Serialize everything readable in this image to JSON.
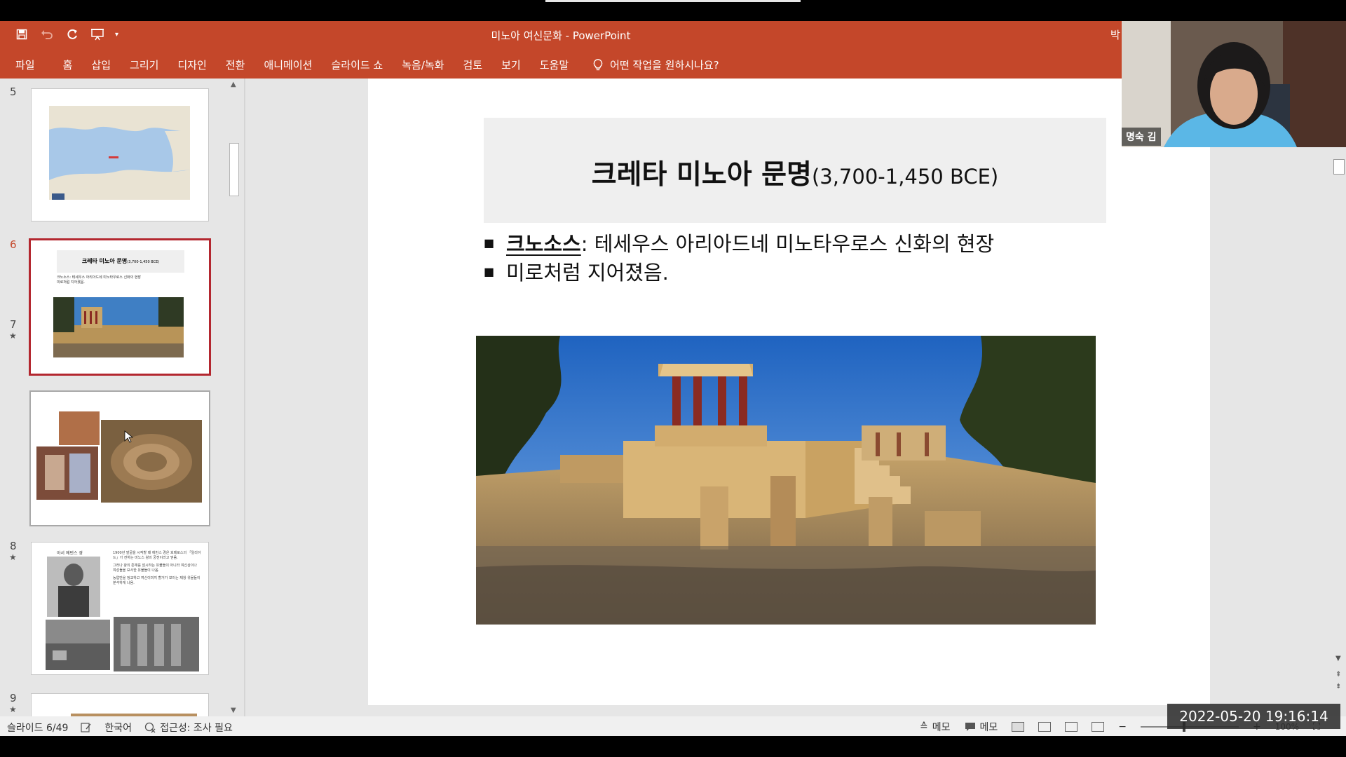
{
  "window": {
    "title": "미노아 여신문화  -  PowerPoint",
    "user_initial": "박",
    "accent": "#c4472a"
  },
  "qat": {
    "icons": [
      "save-icon",
      "undo-icon",
      "redo-icon",
      "present-from-start-icon",
      "customize-qat-icon"
    ]
  },
  "ribbon": {
    "tabs": [
      "파일",
      "홈",
      "삽입",
      "그리기",
      "디자인",
      "전환",
      "애니메이션",
      "슬라이드 쇼",
      "녹음/녹화",
      "검토",
      "보기",
      "도움말"
    ],
    "tell_me": "어떤 작업을 원하시나요?"
  },
  "thumbnails": [
    {
      "number": "5",
      "starred": false,
      "state": "normal"
    },
    {
      "number": "6",
      "starred": false,
      "state": "selected",
      "mini_title": "크레타 미노아 문명",
      "mini_sub": "(3,700-1,450 BCE)",
      "mini_line1": "크노소스: 테세우스 아리아드네 미노타우로스 신화의 현장",
      "mini_line2": "미로처럼 지어졌음."
    },
    {
      "number": "7",
      "starred": true,
      "state": "hover"
    },
    {
      "number": "8",
      "starred": true,
      "state": "normal",
      "mini_caption": "아서 에번스 경",
      "mini_bullets": [
        "1900년 발굴을 시작할 때 에번스 경은 호메로스의 「일리아드」가 전하는 미노스 왕의 궁전이라고 믿음.",
        "그러나 왕의 존재를 암시하는 유물들이 아니라 여신상이나 여성들을 묘사한 유물들이 나옴.",
        "농업만을 정교하고 여신이미지 할거가 보이는 제왕 유물들이 분석하게 나옴."
      ]
    },
    {
      "number": "9",
      "starred": true,
      "state": "normal"
    }
  ],
  "slide": {
    "title_main": "크레타 미노아 문명",
    "title_sub": "(3,700-1,450 BCE)",
    "bullet1_bold": "크노소스",
    "bullet1_rest": ": 테세우스 아리아드네 미노타우로스 신화의 현장",
    "bullet2": "미로처럼 지어졌음.",
    "image": "knossos-palace-photo"
  },
  "statusbar": {
    "slide_counter": "슬라이드 6/49",
    "language": "한국어",
    "accessibility": "접근성: 조사 필요",
    "notes": "메모",
    "comments": "메모",
    "zoom": "100%"
  },
  "webcam": {
    "name": "명숙 김"
  },
  "timestamp": "2022-05-20  19:16:14"
}
